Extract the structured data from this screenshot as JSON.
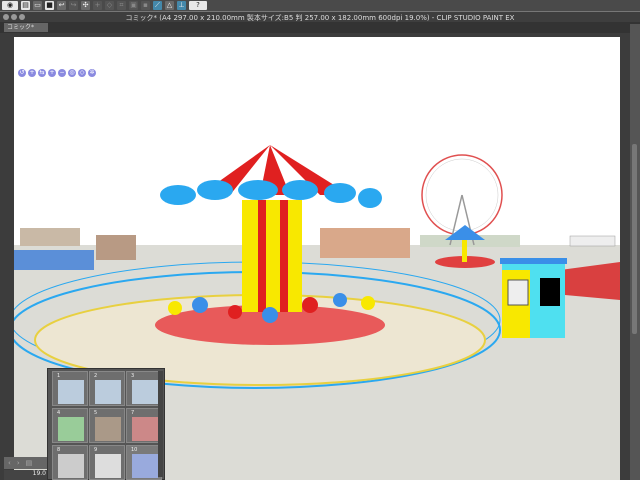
{
  "toolbar": {
    "items": [
      {
        "icon": "eye-icon"
      },
      {
        "icon": "new-icon"
      },
      {
        "icon": "open-icon"
      },
      {
        "icon": "save-icon"
      },
      {
        "icon": "undo-icon"
      },
      {
        "icon": "redo-icon"
      },
      {
        "icon": "transform-icon"
      },
      {
        "icon": "ruler-icon"
      },
      {
        "icon": "fill-icon"
      },
      {
        "icon": "crop-icon"
      },
      {
        "icon": "layer-icon"
      },
      {
        "icon": "snap-icon"
      },
      {
        "icon": "help-icon",
        "label": "?"
      }
    ]
  },
  "window": {
    "title": "コミック* (A4 297.00 x 210.00mm 製本サイズ:B5 判 257.00 x 182.00mm 600dpi 19.0%)  - CLIP STUDIO PAINT EX"
  },
  "tab": {
    "label": "コミック*"
  },
  "status": {
    "zoom": "19.0"
  },
  "pages": [
    {
      "n": "1",
      "color": "#7ab"
    },
    {
      "n": "2",
      "color": "#7ab"
    },
    {
      "n": "3",
      "color": "#7ab"
    },
    {
      "n": "4",
      "color": "#6b6"
    },
    {
      "n": "5",
      "color": "#875"
    },
    {
      "n": "7",
      "color": "#933"
    },
    {
      "n": "8",
      "color": "#998"
    },
    {
      "n": "9",
      "color": "#aa9"
    },
    {
      "n": "10",
      "color": "#56c"
    }
  ],
  "colors": {
    "accent": "#3a8fe8",
    "canopy_red": "#e02020",
    "canopy_blue": "#2aa8f0",
    "pole_yellow": "#f8e800"
  }
}
